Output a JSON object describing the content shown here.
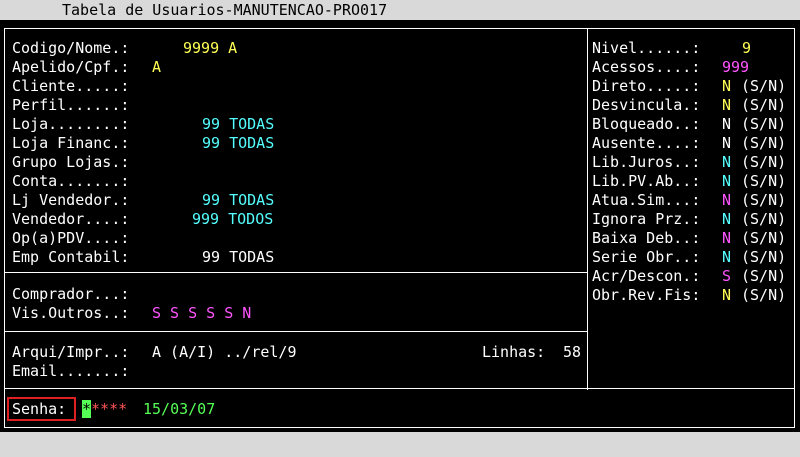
{
  "window": {
    "title": "Tabela de Usuarios-MANUTENCAO-PRO017"
  },
  "left_fields": [
    {
      "label": "Codigo/Nome.:",
      "value": "9999 A",
      "color": "#ffff55"
    },
    {
      "label": "Apelido/Cpf.:",
      "value": "A",
      "color": "#ffff55"
    },
    {
      "label": "Cliente.....:",
      "value": "",
      "color": "#ffffff"
    },
    {
      "label": "Perfil......:",
      "value": "",
      "color": "#ffffff"
    },
    {
      "label": "Loja........:",
      "value": "99 TODAS",
      "color": "#55ffff"
    },
    {
      "label": "Loja Financ.:",
      "value": "99 TODAS",
      "color": "#55ffff"
    },
    {
      "label": "Grupo Lojas.:",
      "value": "",
      "color": "#ffffff"
    },
    {
      "label": "Conta.......:",
      "value": "",
      "color": "#ffffff"
    },
    {
      "label": "Lj Vendedor.:",
      "value": "99 TODAS",
      "color": "#55ffff"
    },
    {
      "label": "Vendedor....:",
      "value": "999 TODOS",
      "color": "#55ffff"
    },
    {
      "label": "Op(a)PDV....:",
      "value": "",
      "color": "#ffffff"
    },
    {
      "label": "Emp Contabil:",
      "value": "99 TODAS",
      "color": "#ffffff"
    }
  ],
  "comprador": {
    "label": "Comprador...:",
    "value": ""
  },
  "vis_outros": {
    "label": "Vis.Outros..:",
    "value": "S S S S S N"
  },
  "arquivo": {
    "label": "Arqui/Impr..:",
    "value": "A (A/I) ../rel/9"
  },
  "linhas": {
    "label": "Linhas:",
    "value": "58"
  },
  "email": {
    "label": "Email.......:",
    "value": ""
  },
  "senha": {
    "label": "Senha:",
    "cursor_char": "*",
    "masked": "****",
    "date": "15/03/07"
  },
  "right_fields": [
    {
      "label": "Nivel......:",
      "value": "9",
      "suffix": "",
      "color": "#ffff55"
    },
    {
      "label": "Acessos....:",
      "value": "999",
      "suffix": "",
      "color": "#ff55ff"
    },
    {
      "label": "Direto.....:",
      "value": "N",
      "suffix": "(S/N)",
      "color": "#ffff55"
    },
    {
      "label": "Desvincula.:",
      "value": "N",
      "suffix": "(S/N)",
      "color": "#ffff55"
    },
    {
      "label": "Bloqueado..:",
      "value": "N",
      "suffix": "(S/N)",
      "color": "#ffffff"
    },
    {
      "label": "Ausente....:",
      "value": "N",
      "suffix": "(S/N)",
      "color": "#ffffff"
    },
    {
      "label": "Lib.Juros..:",
      "value": "N",
      "suffix": "(S/N)",
      "color": "#55ffff"
    },
    {
      "label": "Lib.PV.Ab..:",
      "value": "N",
      "suffix": "(S/N)",
      "color": "#55ffff"
    },
    {
      "label": "Atua.Sim...:",
      "value": "N",
      "suffix": "(S/N)",
      "color": "#ff55ff"
    },
    {
      "label": "Ignora Prz.:",
      "value": "N",
      "suffix": "(S/N)",
      "color": "#55ffff"
    },
    {
      "label": "Baixa Deb..:",
      "value": "N",
      "suffix": "(S/N)",
      "color": "#ff55ff"
    },
    {
      "label": "Serie Obr..:",
      "value": "N",
      "suffix": "(S/N)",
      "color": "#55ffff"
    },
    {
      "label": "Acr/Descon.:",
      "value": "S",
      "suffix": "(S/N)",
      "color": "#ff55ff"
    },
    {
      "label": "Obr.Rev.Fis:",
      "value": "N",
      "suffix": "(S/N)",
      "color": "#ffff55"
    }
  ]
}
